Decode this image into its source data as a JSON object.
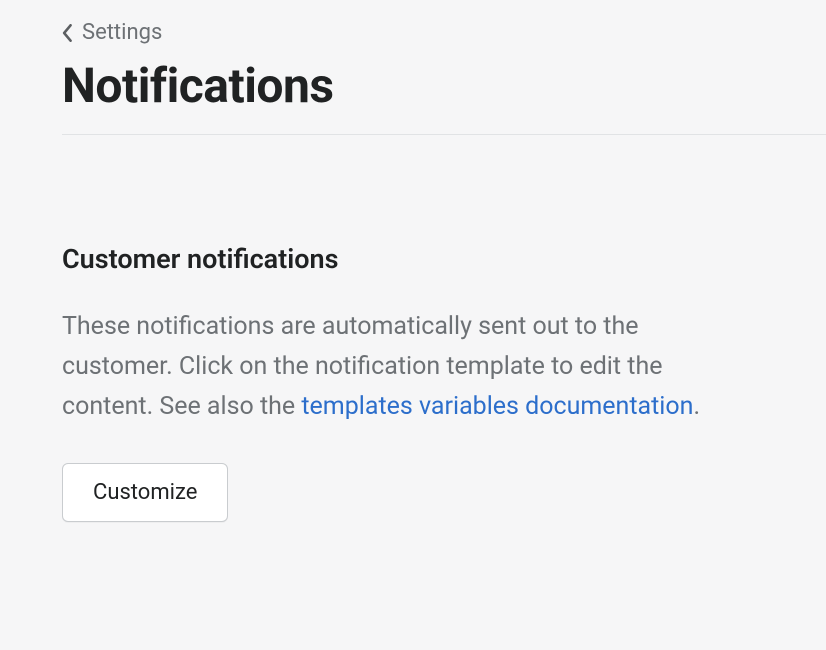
{
  "breadcrumb": {
    "label": "Settings"
  },
  "page": {
    "title": "Notifications"
  },
  "section": {
    "heading": "Customer notifications",
    "description_pre": "These notifications are automatically sent out to the customer. Click on the notification template to edit the content. See also the ",
    "link_text": "templates variables documentation",
    "description_post": ".",
    "button_label": "Customize"
  }
}
